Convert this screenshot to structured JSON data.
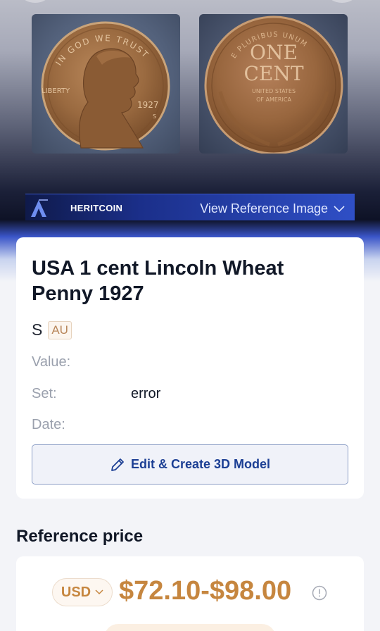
{
  "hero": {
    "obverse": {
      "motto": "IN GOD WE TRUST",
      "inscription": "LIBERTY",
      "year": "1927",
      "mint_mark": "S"
    },
    "reverse": {
      "top_legend": "E PLURIBUS UNUM",
      "denomination_line1": "ONE",
      "denomination_line2": "CENT",
      "country_line1": "UNITED STATES",
      "country_line2": "OF AMERICA"
    },
    "banner": {
      "brand": "HERITCOIN",
      "reference_label": "View Reference Image"
    }
  },
  "detail": {
    "title": "USA 1 cent  Lincoln Wheat Penny 1927",
    "mint": "S",
    "grade": "AU",
    "value_label": "Value:",
    "value": "",
    "set_label": "Set:",
    "set_value": "error",
    "date_label": "Date:",
    "date_value": "",
    "edit_button": "Edit & Create 3D Model"
  },
  "reference_price": {
    "heading": "Reference price",
    "currency": "USD",
    "price_range": "$72.10-$98.00"
  },
  "colors": {
    "accent_gold": "#c6863f",
    "button_blue": "#1c3f94",
    "banner_blue": "#2f4fc6"
  },
  "icons": [
    "chevron-down-icon",
    "pencil-icon",
    "info-icon",
    "heritcoin-logo"
  ]
}
